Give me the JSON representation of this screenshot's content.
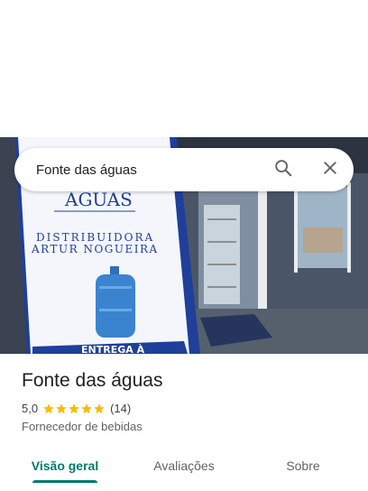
{
  "search": {
    "value": "Fonte das águas"
  },
  "place": {
    "name": "Fonte das águas",
    "rating": "5,0",
    "stars": 5,
    "review_count": "(14)",
    "category": "Fornecedor de bebidas"
  },
  "photo": {
    "banner_line1": "ÁGUAS",
    "banner_line2": "DISTRIBUIDORA",
    "banner_line3": "ARTUR NOGUEIRA",
    "banner_bottom": "ENTREGA À"
  },
  "tabs": [
    {
      "label": "Visão geral",
      "active": true
    },
    {
      "label": "Avaliações",
      "active": false
    },
    {
      "label": "Sobre",
      "active": false
    }
  ],
  "colors": {
    "accent": "#00796b",
    "star": "#fbbc04"
  }
}
